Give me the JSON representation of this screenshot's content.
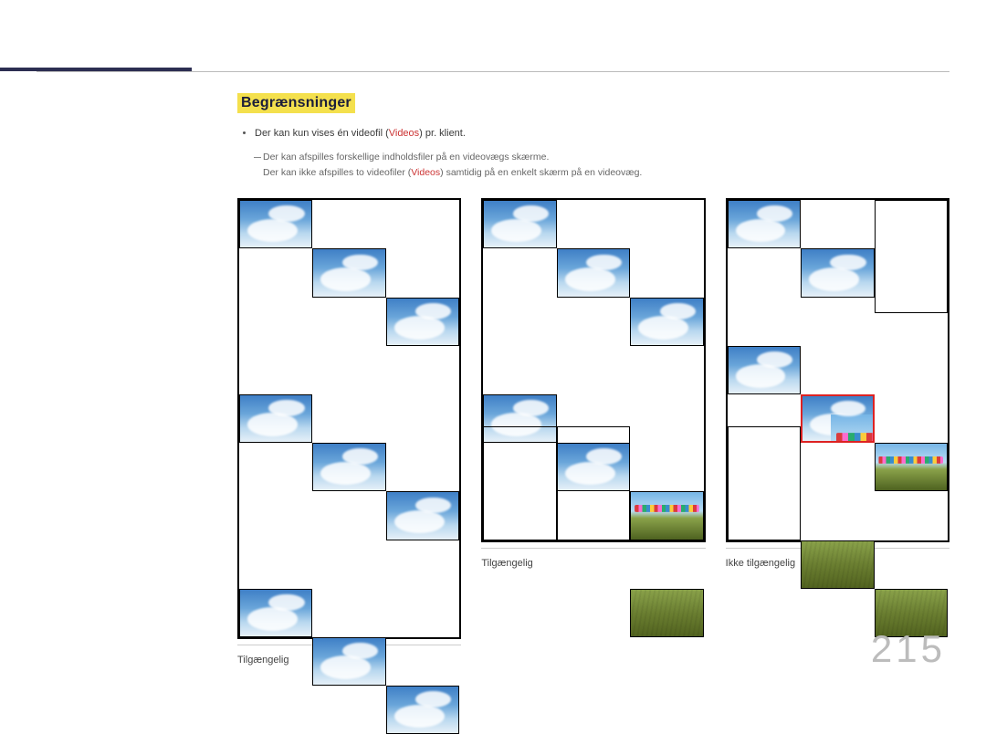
{
  "heading": "Begrænsninger",
  "bullet": {
    "prefix": "Der kan kun vises én videofil (",
    "videos": "Videos",
    "suffix": ") pr. klient."
  },
  "subnote": {
    "line1": "Der kan afspilles forskellige indholdsfiler på en videovægs skærme.",
    "line2_prefix": "Der kan ikke afspilles to videofiler (",
    "line2_videos": "Videos",
    "line2_suffix": ") samtidig på en enkelt skærm på en videovæg."
  },
  "captions": {
    "g1": "Tilgængelig",
    "g2": "Tilgængelig",
    "g3": "Ikke tilgængelig"
  },
  "pagenum": "215"
}
